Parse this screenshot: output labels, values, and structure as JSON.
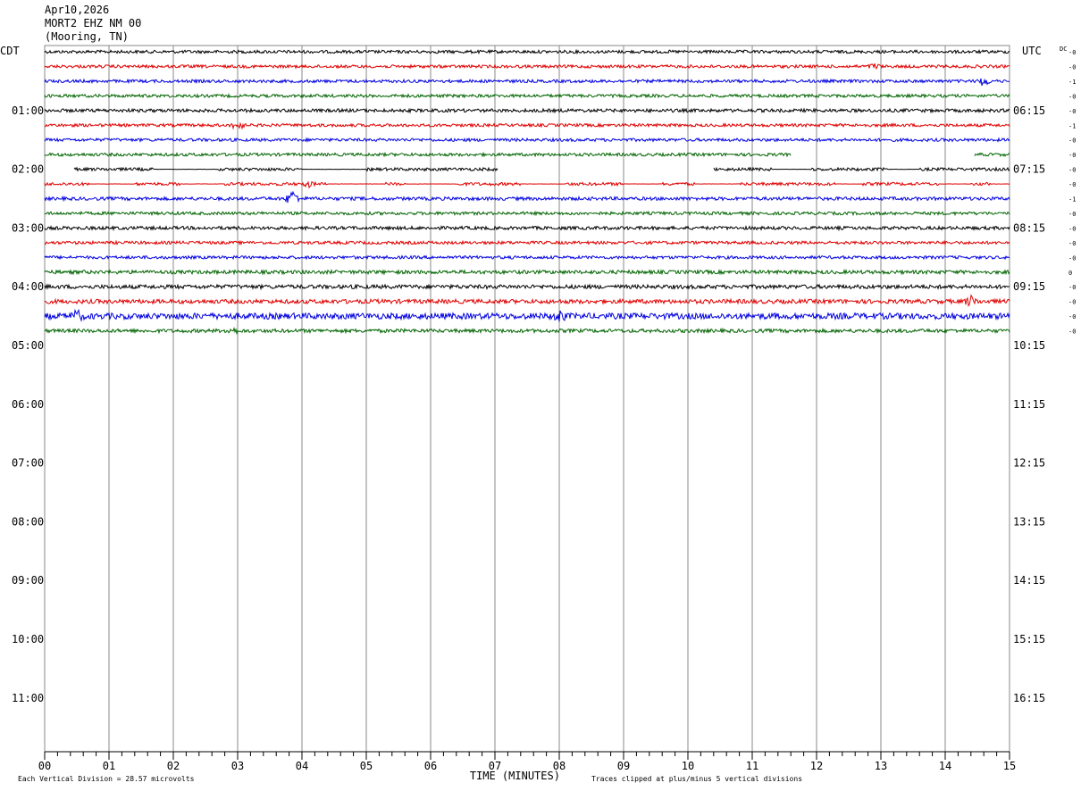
{
  "header": {
    "date": "Apr10,2026",
    "station": "MORT2 EHZ NM 00",
    "location": "(Mooring, TN)"
  },
  "chart_data": {
    "type": "line",
    "subtype": "helicorder",
    "left_timezone": "CDT",
    "right_timezone": "UTC",
    "dc_label": "DC",
    "left_hour_labels": [
      "01:00",
      "02:00",
      "03:00",
      "04:00",
      "05:00",
      "06:00",
      "07:00",
      "08:00",
      "09:00",
      "10:00",
      "11:00"
    ],
    "right_hour_labels": [
      "06:15",
      "07:15",
      "08:15",
      "09:15",
      "10:15",
      "11:15",
      "12:15",
      "13:15",
      "14:15",
      "15:15",
      "16:15"
    ],
    "x_ticks": [
      "00",
      "01",
      "02",
      "03",
      "04",
      "05",
      "06",
      "07",
      "08",
      "09",
      "10",
      "11",
      "12",
      "13",
      "14",
      "15"
    ],
    "xlim": [
      0,
      15
    ],
    "xlabel": "TIME (MINUTES)",
    "rows_per_hour": 4,
    "minutes_per_row": 15,
    "total_rows_axis": 48,
    "grid": true,
    "trace_colors": [
      "#000000",
      "#e00000",
      "#0000e0",
      "#006400"
    ],
    "traces": [
      {
        "dc": "-0",
        "amp": 1.0,
        "events": []
      },
      {
        "dc": "-0",
        "amp": 1.0,
        "events": [
          {
            "x": 12.9,
            "a": 1.5
          }
        ]
      },
      {
        "dc": "-1",
        "amp": 1.0,
        "events": [
          {
            "x": 14.6,
            "a": 3
          }
        ]
      },
      {
        "dc": "-0",
        "amp": 1.0,
        "events": []
      },
      {
        "dc": "-0",
        "amp": 1.1,
        "events": []
      },
      {
        "dc": "-1",
        "amp": 1.0,
        "events": [
          {
            "x": 3.0,
            "a": 3
          }
        ]
      },
      {
        "dc": "-0",
        "amp": 1.0,
        "events": []
      },
      {
        "dc": "-0",
        "amp": 1.0,
        "events": [],
        "gaps": [
          [
            11.6,
            14.45
          ]
        ]
      },
      {
        "dc": "-0",
        "amp": 1.0,
        "events": [],
        "gaps": [
          [
            0,
            0.45
          ],
          [
            7.05,
            10.4
          ]
        ],
        "quiet": [
          [
            1.7,
            2.7
          ],
          [
            4.0,
            5.0
          ],
          [
            8.1,
            8.5
          ],
          [
            11.3,
            11.9
          ],
          [
            13.1,
            13.6
          ]
        ]
      },
      {
        "dc": "-0",
        "amp": 1.0,
        "events": [
          {
            "x": 4.1,
            "a": 1.5
          }
        ],
        "quiet": [
          [
            0.7,
            1.4
          ],
          [
            2.1,
            2.8
          ],
          [
            4.4,
            5.3
          ],
          [
            5.6,
            6.4
          ],
          [
            7.4,
            8.1
          ],
          [
            9.0,
            9.6
          ],
          [
            10.1,
            10.8
          ],
          [
            12.3,
            12.7
          ],
          [
            13.9,
            14.4
          ],
          [
            14.7,
            15
          ]
        ]
      },
      {
        "dc": "-1",
        "amp": 1.1,
        "events": [
          {
            "x": 3.85,
            "a": 5
          }
        ]
      },
      {
        "dc": "-0",
        "amp": 1.0,
        "events": []
      },
      {
        "dc": "-0",
        "amp": 1.1,
        "events": []
      },
      {
        "dc": "-0",
        "amp": 1.0,
        "events": []
      },
      {
        "dc": "-0",
        "amp": 1.0,
        "events": []
      },
      {
        "dc": "0",
        "amp": 1.2,
        "events": []
      },
      {
        "dc": "-0",
        "amp": 1.3,
        "events": []
      },
      {
        "dc": "-0",
        "amp": 1.4,
        "events": [
          {
            "x": 14.4,
            "a": 2.2
          }
        ]
      },
      {
        "dc": "-0",
        "amp": 2.0,
        "events": [
          {
            "x": 8.0,
            "a": 1.6
          },
          {
            "x": 0.5,
            "a": 1.4
          }
        ]
      },
      {
        "dc": "-0",
        "amp": 1.2,
        "events": [
          {
            "x": 2.9,
            "a": 1.5
          }
        ]
      }
    ],
    "footer_left": "Each Vertical Division =   28.57 microvolts",
    "footer_right": "Traces clipped at plus/minus 5 vertical divisions"
  }
}
